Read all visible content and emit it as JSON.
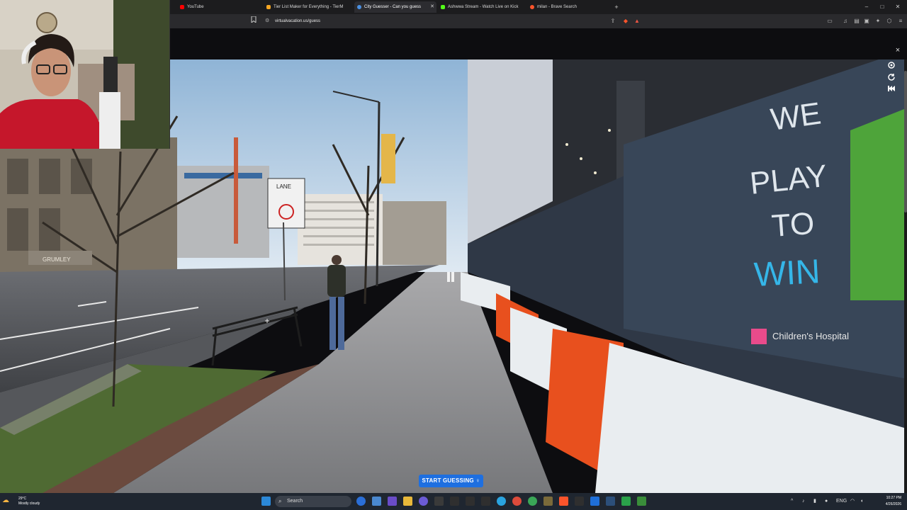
{
  "browser": {
    "tabs": [
      {
        "label": "YouTube",
        "color": "#ff0000"
      },
      {
        "label": "Tier List Maker for Everything - TierM",
        "color": "#f5a623"
      },
      {
        "label": "City Guesser - Can you guess",
        "color": "#4a90e2",
        "active": true
      },
      {
        "label": "Ashwwa Stream - Watch Live on Kick",
        "color": "#53fc18"
      },
      {
        "label": "milan - Brave Search",
        "color": "#fb542b"
      }
    ],
    "new_tab": "+",
    "url": "virtualvacation.us/guess",
    "window_controls": {
      "minimize": "–",
      "maximize": "□",
      "close": "✕"
    }
  },
  "panorama": {
    "start_button": "START GUESSING ♀",
    "sign_text": "LANE",
    "banner_text_1": "WE",
    "banner_text_2": "PLAY",
    "banner_text_3": "TO",
    "banner_text_4": "WIN",
    "banner_logo": "Children's Hospital",
    "building_sign": "GRUMLEY",
    "close": "×",
    "controls": [
      "target-icon",
      "refresh-icon",
      "skip-back-icon"
    ]
  },
  "taskbar": {
    "weather_temp": "29°C",
    "weather_desc": "Mostly cloudy",
    "search_placeholder": "Search",
    "lang": "ENG",
    "time": "10:27 PM",
    "date": "4/26/2026"
  },
  "colors": {
    "accent": "#1e6fe0",
    "barrier_orange": "#e8501e",
    "barrier_white": "#e9edf0"
  }
}
